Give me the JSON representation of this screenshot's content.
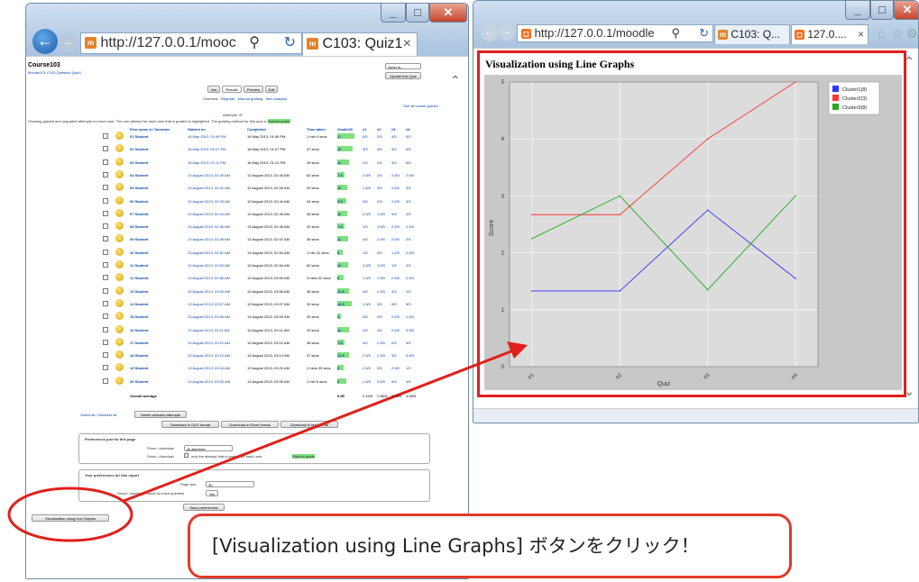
{
  "colors": {
    "highlight_red": "#e0201c",
    "grade_bar": "#7fe07f",
    "link_blue": "#0645ad"
  },
  "left_window": {
    "address": "http://127.0.0.1/mooc",
    "tab_title": "C103: Quiz1",
    "favicon": "m",
    "course_name": "Course103",
    "breadcrumb": "Moodle101  C103  Question  Quiz1",
    "update_button": "Update this Quiz",
    "jump_select": "Jump to...",
    "top_tabs": [
      "Info",
      "Results",
      "Preview",
      "Edit"
    ],
    "sub_tabs": [
      "Overview",
      "Regrade",
      "Manual grading",
      "Item analysis"
    ],
    "see_all": "See all course grades",
    "attempts": "Attempts: 20",
    "description": "Showing graded and ungraded attempts for each user. The one attempt for each user that is graded is highlighted. The grading method for this quiz is",
    "grading_method": "Highest grade",
    "columns": [
      "First name A / Surname",
      "Started on",
      "Completed",
      "Time taken",
      "Grade/20",
      "#1",
      "#2",
      "#3",
      "#4"
    ],
    "rows": [
      {
        "name": "01 Student",
        "started": "16 May 2013, 01:06 PM",
        "completed": "16 May 2013, 01:06 PM",
        "time": "1 min 4 secs",
        "grade": "17",
        "q": [
          "5/5",
          "3/5",
          "4/5",
          "5/5"
        ]
      },
      {
        "name": "02 Student",
        "started": "16 May 2013, 01:07 PM",
        "completed": "16 May 2013, 01:07 PM",
        "time": "47 secs",
        "grade": "15",
        "q": [
          "3/5",
          "4/5",
          "3/5",
          "5/5"
        ]
      },
      {
        "name": "03 Student",
        "started": "16 May 2013, 01:11 PM",
        "completed": "16 May 2013, 01:12 PM",
        "time": "49 secs",
        "grade": "12",
        "q": [
          "2/5",
          "2/5",
          "3/5",
          "5/5"
        ]
      },
      {
        "name": "04 Student",
        "started": "13 August 2013, 02:39 AM",
        "completed": "13 August 2013, 02:40 AM",
        "time": "62 secs",
        "grade": "7.5",
        "q": [
          "2.5/5",
          "2/5",
          "2.5/5",
          "2.5/5"
        ]
      },
      {
        "name": "05 Student",
        "started": "13 August 2013, 02:42 AM",
        "completed": "13 August 2013, 02:43 AM",
        "time": "29 secs",
        "grade": "10",
        "q": [
          "1.5/5",
          "3/5",
          "2.5/5",
          "3/5"
        ]
      },
      {
        "name": "06 Student",
        "started": "13 August 2013, 02:43 AM",
        "completed": "13 August 2013, 02:44 AM",
        "time": "34 secs",
        "grade": "9.5",
        "q": [
          "3/5",
          "2/5",
          "2.5/5",
          "3/5"
        ]
      },
      {
        "name": "07 Student",
        "started": "13 August 2013, 02:44 AM",
        "completed": "13 August 2013, 02:45 AM",
        "time": "38 secs",
        "grade": "10",
        "q": [
          "2.5/5",
          "1.5/5",
          "4/5",
          "2/5"
        ]
      },
      {
        "name": "08 Student",
        "started": "13 August 2013, 02:45 AM",
        "completed": "13 August 2013, 02:46 AM",
        "time": "32 secs",
        "grade": "7.5",
        "q": [
          "1/5",
          "1.5/5",
          "2.5/5",
          "2.5/5"
        ]
      },
      {
        "name": "09 Student",
        "started": "13 August 2013, 02:46 AM",
        "completed": "13 August 2013, 02:47 AM",
        "time": "36 secs",
        "grade": "11",
        "q": [
          "4/5",
          "2.5/5",
          "2.5/5",
          "2/5"
        ]
      },
      {
        "name": "10 Student",
        "started": "13 August 2013, 02:51 AM",
        "completed": "13 August 2013, 02:53 AM",
        "time": "1 min 31 secs",
        "grade": "5",
        "q": [
          "1/5",
          "0/5",
          "1.5/5",
          "2.5/5"
        ]
      },
      {
        "name": "11 Student",
        "started": "13 August 2013, 02:53 AM",
        "completed": "13 August 2013, 02:54 AM",
        "time": "60 secs",
        "grade": "11",
        "q": [
          "2.5/5",
          "3.5/5",
          "1/5",
          "4/5"
        ]
      },
      {
        "name": "12 Student",
        "started": "13 August 2013, 02:56 AM",
        "completed": "13 August 2013, 03:00 AM",
        "time": "3 mins 22 secs",
        "grade": "6",
        "q": [
          "1.5/5",
          "1.5/5",
          "2.5/5",
          "0.5/5"
        ]
      },
      {
        "name": "13 Student",
        "started": "13 August 2013, 03:05 AM",
        "completed": "13 August 2013, 03:06 AM",
        "time": "46 secs",
        "grade": "11.5",
        "q": [
          "3/5",
          "2.5/5",
          "4/5",
          "2/5"
        ]
      },
      {
        "name": "14 Student",
        "started": "13 August 2013, 03:07 AM",
        "completed": "13 August 2013, 03:07 AM",
        "time": "39 secs",
        "grade": "14.5",
        "q": [
          "1.5/5",
          "3/5",
          "5/5",
          "5/5"
        ]
      },
      {
        "name": "15 Student",
        "started": "13 August 2013, 03:08 AM",
        "completed": "13 August 2013, 03:09 AM",
        "time": "39 secs",
        "grade": "4",
        "q": [
          "0/5",
          "0/5",
          "2.5/5",
          "1.5/5"
        ]
      },
      {
        "name": "16 Student",
        "started": "13 August 2013, 03:11 AM",
        "completed": "13 August 2013, 03:11 AM",
        "time": "33 secs",
        "grade": "12",
        "q": [
          "2/5",
          "4/5",
          "2.5/5",
          "3.5/5"
        ]
      },
      {
        "name": "17 Student",
        "started": "13 August 2013, 03:12 AM",
        "completed": "13 August 2013, 03:12 AM",
        "time": "36 secs",
        "grade": "7.5",
        "q": [
          "0/5",
          "2.5/5",
          "2/5",
          "3/5"
        ]
      },
      {
        "name": "18 Student",
        "started": "13 August 2013, 03:13 AM",
        "completed": "13 August 2013, 03:14 AM",
        "time": "47 secs",
        "grade": "11.5",
        "q": [
          "2.5/5",
          "2.5/5",
          "3/5",
          "3.5/5"
        ]
      },
      {
        "name": "19 Student",
        "started": "13 August 2013, 03:18 AM",
        "completed": "13 August 2013, 03:21 AM",
        "time": "2 mins 39 secs",
        "grade": "6",
        "q": [
          "2.5/5",
          "0/5",
          "2.5/5",
          "1/5"
        ]
      },
      {
        "name": "20 Student",
        "started": "13 August 2013, 03:23 AM",
        "completed": "13 August 2013, 03:26 AM",
        "time": "1 min 9 secs",
        "grade": "9",
        "q": [
          "1.5/5",
          "3.5/5",
          "0/5",
          "4/5"
        ]
      }
    ],
    "overall_label": "Overall average",
    "overall": {
      "grade": "9.95",
      "q": [
        "2.15/5",
        "2.58/5",
        "2.73/5",
        "3.08/5"
      ]
    },
    "select_links": "Select all / Deselect all",
    "delete_button": "Delete selected attempts",
    "download_buttons": [
      "Download in ODS format",
      "Download in Excel format",
      "Download in text format"
    ],
    "pref_page_title": "Preferences just for this page",
    "show_download_label": "Show / download",
    "show_download_select": "all attempts",
    "only_graded_text": "only the attempt that is graded for each user",
    "pref_report_title": "Your preferences for this report",
    "page_size_label": "Page size",
    "page_size_value": "30",
    "marks_label": "Show / download marks for each question",
    "marks_value": "Yes",
    "save_button": "Save preferences",
    "visualize_button": "Visualization using Line Graphs"
  },
  "right_window": {
    "address": "http://127.0.0.1/moodle",
    "tabs": [
      "C103: Q...",
      "127.0...."
    ],
    "heading": "Visualization using Line Graphs"
  },
  "chart_data": {
    "type": "line",
    "title": "Visualization using Line Graphs",
    "x": [
      "#1",
      "#2",
      "#3",
      "#4"
    ],
    "xlabel": "Quiz",
    "ylabel": "Score",
    "ylim": [
      0,
      5
    ],
    "yticks": [
      "0",
      "1",
      "2",
      "3",
      "4",
      "5"
    ],
    "grid": true,
    "legend_position": "top-right",
    "series": [
      {
        "name": "Cluster1(8)",
        "color": "#3333ff",
        "values": [
          1.33,
          1.33,
          2.75,
          1.55
        ]
      },
      {
        "name": "Cluster2(3)",
        "color": "#ff3333",
        "values": [
          2.67,
          2.67,
          4.0,
          5.0
        ]
      },
      {
        "name": "Cluster3(8)",
        "color": "#22aa22",
        "values": [
          2.25,
          3.0,
          1.35,
          3.0
        ]
      }
    ]
  },
  "callout": {
    "text": "[Visualization using Line Graphs] ボタンをクリック！"
  }
}
